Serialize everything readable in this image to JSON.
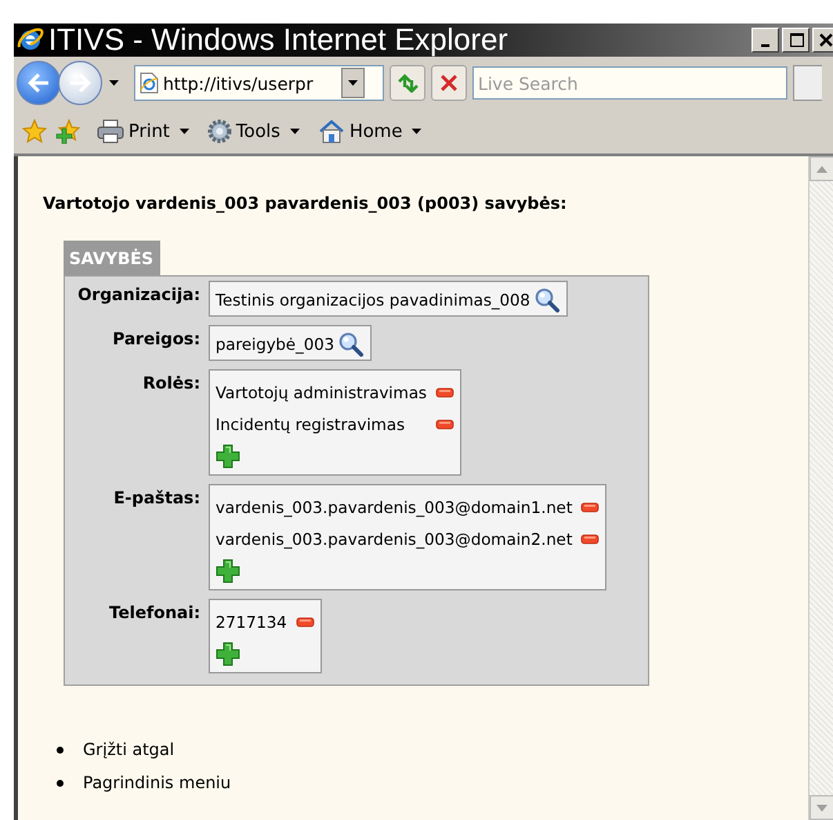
{
  "window": {
    "title": "ITIVS - Windows Internet Explorer"
  },
  "address_bar": {
    "value": "http://itivs/userpr"
  },
  "search": {
    "placeholder": "Live Search"
  },
  "toolbar": [
    {
      "kind": "print",
      "label": "Print"
    },
    {
      "kind": "tools",
      "label": "Tools"
    },
    {
      "kind": "home",
      "label": "Home"
    }
  ],
  "page": {
    "heading": "Vartotojo vardenis_003 pavardenis_003 (p003) savybės:",
    "section_title": "SAVYBĖS",
    "fields": [
      {
        "label": "Organizacija:",
        "kind": "lookup",
        "value": "Testinis organizacijos pavadinimas_008"
      },
      {
        "label": "Pareigos:",
        "kind": "lookup",
        "value": "pareigybė_003"
      },
      {
        "label": "Rolės:",
        "kind": "list",
        "items": [
          "Vartotojų administravimas",
          "Incidentų registravimas"
        ]
      },
      {
        "label": "E-paštas:",
        "kind": "list",
        "items": [
          "vardenis_003.pavardenis_003@domain1.net",
          "vardenis_003.pavardenis_003@domain2.net"
        ]
      },
      {
        "label": "Telefonai:",
        "kind": "list",
        "items": [
          "2717134"
        ]
      }
    ],
    "links": [
      "Grįžti atgal",
      "Pagrindinis meniu"
    ]
  }
}
